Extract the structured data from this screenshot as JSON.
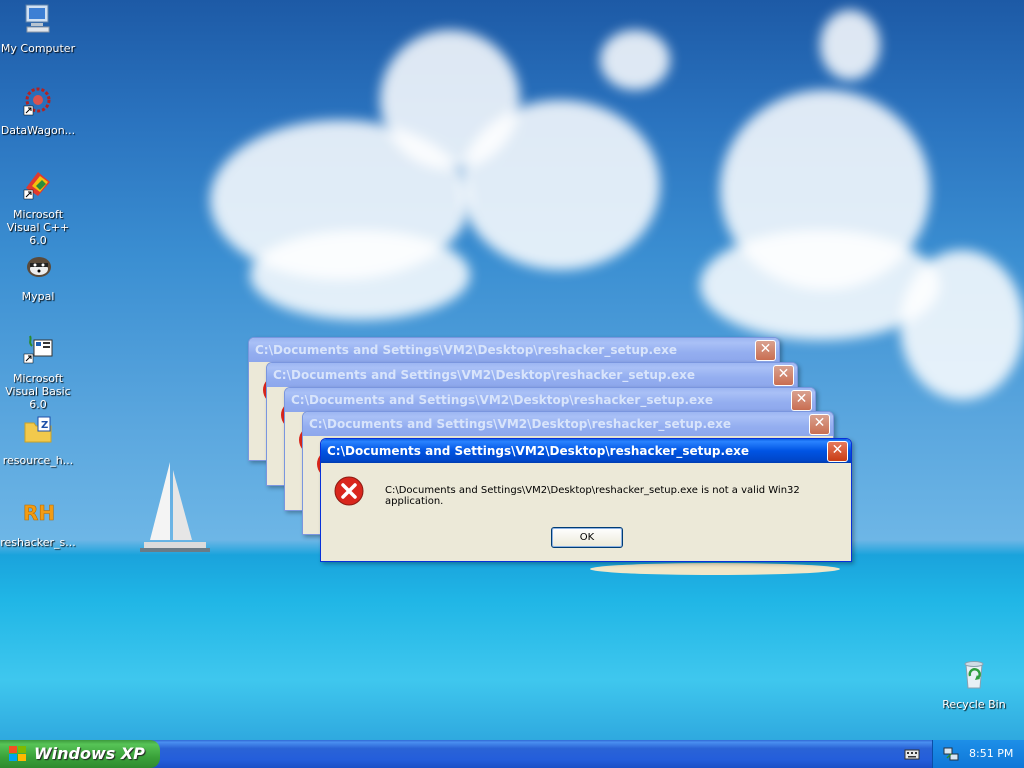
{
  "desktop_icons": [
    {
      "label": "My Computer",
      "icon": "my-computer-icon"
    },
    {
      "label": "DataWagon...",
      "icon": "datawagon-icon"
    },
    {
      "label": "Microsoft Visual C++ 6.0",
      "icon": "visual-cpp-icon"
    },
    {
      "label": "Mypal",
      "icon": "mypal-icon"
    },
    {
      "label": "Microsoft Visual Basic 6.0",
      "icon": "visual-basic-icon"
    },
    {
      "label": "resource_h...",
      "icon": "zip-folder-icon"
    },
    {
      "label": "reshacker_s...",
      "icon": "reshacker-icon"
    },
    {
      "label": "Recycle Bin",
      "icon": "recycle-bin-icon"
    }
  ],
  "dialog": {
    "title": "C:\\Documents and Settings\\VM2\\Desktop\\reshacker_setup.exe",
    "message": "C:\\Documents and Settings\\VM2\\Desktop\\reshacker_setup.exe is not a valid Win32 application.",
    "ok_label": "OK",
    "close_glyph": "✕"
  },
  "taskbar": {
    "start_label": "Windows XP",
    "clock": "8:51 PM"
  },
  "colors": {
    "titlebar_active": "#0054e3",
    "start_green": "#3aa23a",
    "taskbar_blue": "#245edb"
  }
}
